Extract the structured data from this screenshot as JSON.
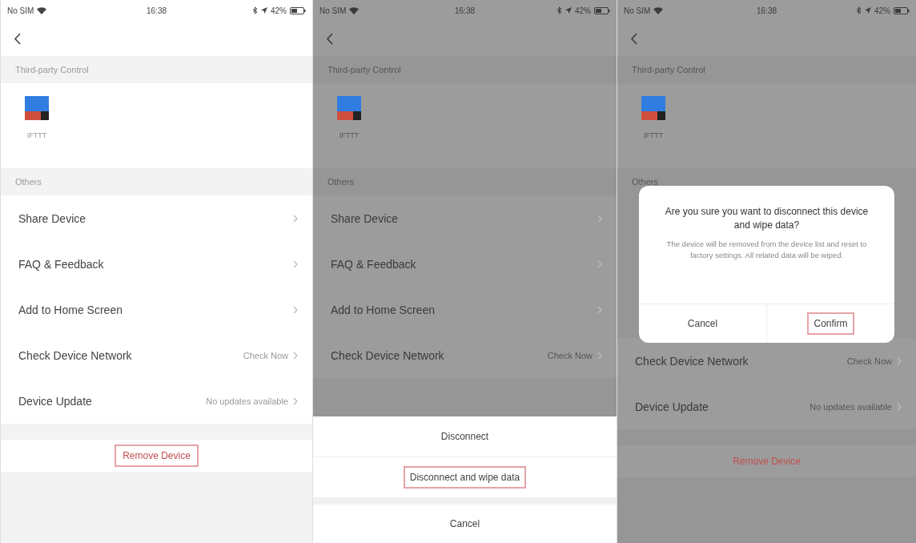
{
  "screens": [
    {
      "status_bar": {
        "carrier": "No SIM",
        "time": "16:38",
        "battery": "42%"
      },
      "dimmed": false,
      "sections": [
        {
          "kind": "tiles",
          "header": "Third-party Control",
          "tiles": [
            {
              "label": "IFTTT"
            }
          ]
        },
        {
          "kind": "list",
          "header": "Others",
          "rows": [
            {
              "label": "Share Device"
            },
            {
              "label": "FAQ & Feedback"
            },
            {
              "label": "Add to Home Screen"
            },
            {
              "label": "Check Device Network",
              "value": "Check Now"
            },
            {
              "label": "Device Update",
              "value": "No updates available"
            }
          ]
        }
      ],
      "remove_button": {
        "label": "Remove Device",
        "highlighted": true
      }
    },
    {
      "status_bar": {
        "carrier": "No SIM",
        "time": "16:38",
        "battery": "42%"
      },
      "dimmed": true,
      "sections": [
        {
          "kind": "tiles",
          "header": "Third-party Control",
          "tiles": [
            {
              "label": "IFTTT"
            }
          ]
        },
        {
          "kind": "list",
          "header": "Others",
          "rows": [
            {
              "label": "Share Device"
            },
            {
              "label": "FAQ & Feedback"
            },
            {
              "label": "Add to Home Screen"
            },
            {
              "label": "Check Device Network",
              "value": "Check Now"
            }
          ]
        }
      ],
      "action_sheet": {
        "options": [
          {
            "label": "Disconnect",
            "highlighted": false
          },
          {
            "label": "Disconnect and wipe data",
            "highlighted": true
          }
        ],
        "cancel": "Cancel"
      }
    },
    {
      "status_bar": {
        "carrier": "No SIM",
        "time": "16:38",
        "battery": "42%"
      },
      "dimmed": true,
      "sections": [
        {
          "kind": "tiles",
          "header": "Third-party Control",
          "tiles": [
            {
              "label": "IFTTT"
            }
          ]
        },
        {
          "kind": "list",
          "header": "Others",
          "rows": [
            {
              "label": "Check Device Network",
              "value": "Check Now"
            },
            {
              "label": "Device Update",
              "value": "No updates available"
            }
          ]
        }
      ],
      "dialog": {
        "title": "Are you sure you want to disconnect this device and wipe data?",
        "message": "The device will be removed from the device list and reset to factory settings. All related data will be wiped.",
        "buttons": [
          {
            "label": "Cancel",
            "highlighted": false
          },
          {
            "label": "Confirm",
            "highlighted": true
          }
        ]
      },
      "remove_button": {
        "label": "Remove Device",
        "highlighted": false
      }
    }
  ]
}
